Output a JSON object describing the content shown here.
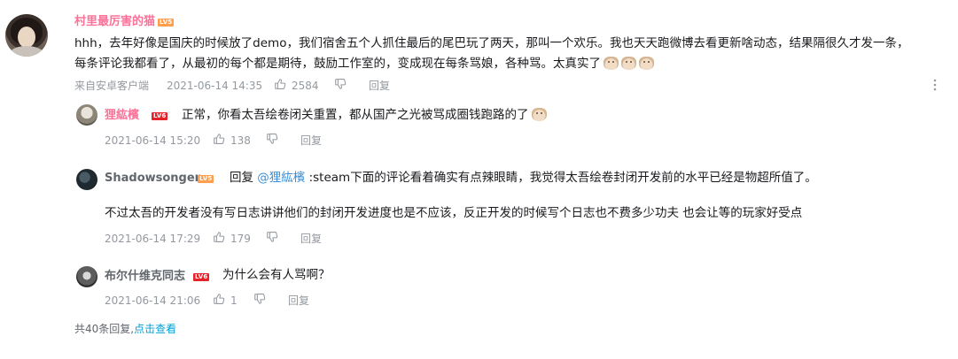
{
  "main_comment": {
    "username": "村里最厉害的猫",
    "level": "LV5",
    "line1": "hhh，去年好像是国庆的时候放了demo，我们宿舍五个人抓住最后的尾巴玩了两天，那叫一个欢乐。我也天天跑微博去看更新啥动态，结果隔很久才发一条，",
    "line2": "每条评论我都看了，从最初的每个都是期待，鼓励工作室的，变成现在每条骂娘，各种骂。太真实了",
    "source": "来自安卓客户端",
    "timestamp": "2021-06-14 14:35",
    "likes": "2584",
    "reply_label": "回复"
  },
  "replies": [
    {
      "username": "狸紘檳",
      "level": "LV6",
      "text": "正常，你看太吾绘卷闭关重置，都从国产之光被骂成圈钱跑路的了",
      "timestamp": "2021-06-14 15:20",
      "likes": "138",
      "reply_label": "回复"
    },
    {
      "username": "Shadowsonger",
      "level": "LV5",
      "reply_prefix": "回复 ",
      "mention": "@狸紘檳",
      "text_line1": " :steam下面的评论看着确实有点辣眼睛，我觉得太吾绘卷封闭开发前的水平已经是物超所值了。",
      "text_line2": "不过太吾的开发者没有写日志讲讲他们的封闭开发进度也是不应该，反正开发的时候写个日志也不费多少功夫 也会让等的玩家好受点",
      "timestamp": "2021-06-14 17:29",
      "likes": "179",
      "reply_label": "回复"
    },
    {
      "username": "布尔什维克同志",
      "level": "LV6",
      "text": "为什么会有人骂啊？",
      "timestamp": "2021-06-14 21:06",
      "likes": "1",
      "reply_label": "回复"
    }
  ],
  "footer": {
    "total_text": "共40条回复,",
    "view_link": "点击查看"
  },
  "colors": {
    "pink_name": "#fb7299",
    "meta_gray": "#9499a0",
    "link_blue": "#00a1d6",
    "mention_blue": "#3a8fd6"
  },
  "icons": {
    "like": "thumbs-up-icon",
    "dislike": "thumbs-down-icon",
    "more": "more-vertical-icon",
    "emoji": "doge-emoji-icon"
  }
}
